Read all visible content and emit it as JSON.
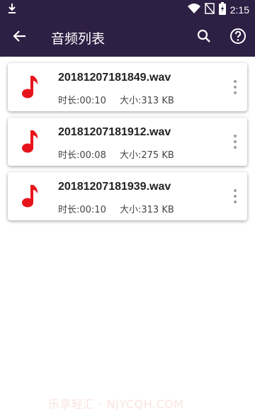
{
  "status_bar": {
    "time": "2:15",
    "download_icon": "download-icon",
    "wifi_icon": "wifi-icon",
    "signal_icon": "no-signal-icon",
    "battery_icon": "battery-charging-icon"
  },
  "app_bar": {
    "back_icon": "arrow-back-icon",
    "title": "音频列表",
    "search_icon": "search-icon",
    "help_icon": "help-circle-icon",
    "background": "#2e1f44"
  },
  "files": [
    {
      "name": "20181207181849.wav",
      "duration": "时长:00:10",
      "size": "大小:313 KB"
    },
    {
      "name": "20181207181912.wav",
      "duration": "时长:00:08",
      "size": "大小:275 KB"
    },
    {
      "name": "20181207181939.wav",
      "duration": "时长:00:10",
      "size": "大小:313 KB"
    }
  ],
  "colors": {
    "accent_note": "#e8141b"
  },
  "watermark": "乐享轻汇 · NJYCQH.COM"
}
